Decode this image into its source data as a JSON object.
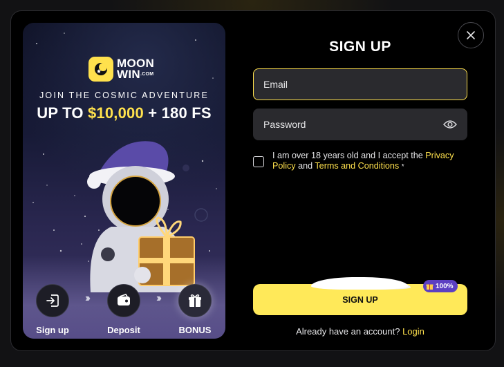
{
  "promo": {
    "logo_line1": "MOON",
    "logo_line2": "WIN",
    "logo_suffix": ".COM",
    "tagline": "JOIN THE COSMIC ADVENTURE",
    "headline_prefix": "UP TO ",
    "headline_amount": "$10,000",
    "headline_suffix": " + 180 FS",
    "steps": [
      {
        "label": "Sign up",
        "icon": "sign-in-icon"
      },
      {
        "label": "Deposit",
        "icon": "wallet-icon"
      },
      {
        "label": "BONUS",
        "icon": "gift-icon"
      }
    ]
  },
  "form": {
    "title": "SIGN UP",
    "email_placeholder": "Email",
    "password_placeholder": "Password",
    "agree_text_1": "I am over 18 years old and I accept the ",
    "privacy_link": "Privacy Policy",
    "agree_and": " and ",
    "terms_link": "Terms and Conditions",
    "required_mark": "*",
    "submit_label": "SIGN UP",
    "bonus_badge": "100%",
    "login_prompt": "Already have an account? ",
    "login_link": "Login"
  },
  "colors": {
    "accent": "#ffe14d",
    "button": "#ffe959",
    "badge": "#5c3fc2"
  }
}
